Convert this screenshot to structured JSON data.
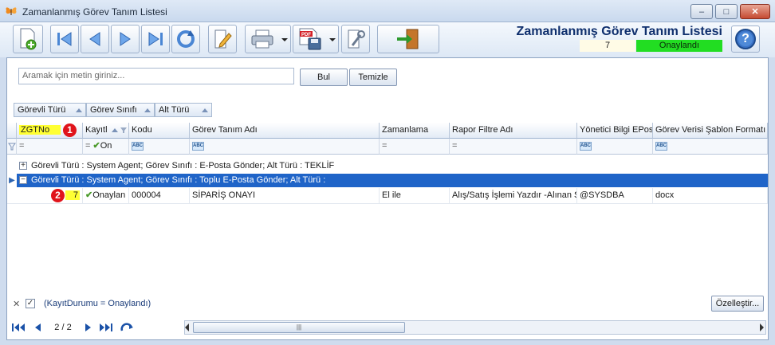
{
  "window": {
    "title": "Zamanlanmış Görev Tanım Listesi",
    "minimize": "–",
    "maximize": "□",
    "close": "✕"
  },
  "header": {
    "list_title": "Zamanlanmış Görev Tanım Listesi",
    "record_count": "7",
    "status": "Onaylandı",
    "help": "?"
  },
  "colors": {
    "status_green": "#22dd22",
    "selected_row": "#1f64c8",
    "badge_red": "#e0141b",
    "highlight_yellow": "#ffff33"
  },
  "search": {
    "placeholder": "Aramak için metin giriniz...",
    "find_label": "Bul",
    "clear_label": "Temizle"
  },
  "group_by": [
    "Görevli Türü",
    "Görev Sınıfı",
    "Alt Türü"
  ],
  "columns": {
    "zgtno": "ZGTNo",
    "kayit": "Kayıtl",
    "kodu": "Kodu",
    "gorev_tanim_adi": "Görev Tanım Adı",
    "zamanlama": "Zamanlama",
    "rapor_filtre_adi": "Rapor Filtre Adı",
    "yonetici_eposta": "Yönetici Bilgi EPosta",
    "sablon_formati": "Görev Verisi Şablon Formatı"
  },
  "filter_row": {
    "eq": "=",
    "kayit_value": "On"
  },
  "groups": [
    {
      "text": "Görevli Türü : System Agent;  Görev Sınıfı : E-Posta Gönder;  Alt Türü : TEKLİF",
      "expander": "+"
    },
    {
      "text": "Görevli Türü : System Agent;  Görev Sınıfı : Toplu E-Posta Gönder;  Alt Türü :",
      "expander": "−"
    }
  ],
  "row": {
    "zgtno": "7",
    "kayit": "Onaylan",
    "kodu": "000004",
    "gorev_tanim_adi": "SİPARİŞ ONAYI",
    "zamanlama": "El ile",
    "rapor_filtre_adi": "Alış/Satış İşlemi Yazdır -Alınan Sip",
    "yonetici_eposta": "@SYSDBA",
    "sablon_formati": "docx"
  },
  "badges": {
    "one": "1",
    "two": "2"
  },
  "filter_bar": {
    "remove": "✕",
    "expression": "(KayıtDurumu = Onaylandı)",
    "customize_label": "Özelleştir..."
  },
  "navigator": {
    "page_info": "2 / 2"
  }
}
